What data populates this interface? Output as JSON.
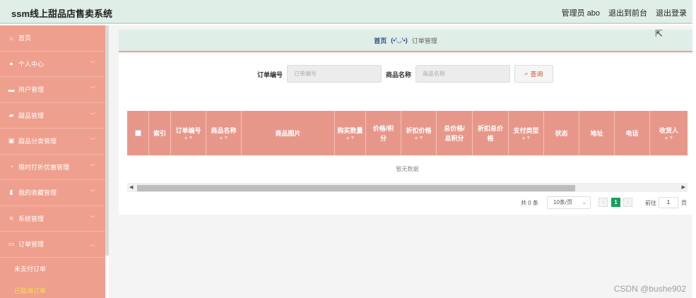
{
  "header": {
    "title": "ssm线上甜品店售卖系统",
    "user": "管理员 abo",
    "to_front": "退出到前台",
    "logout": "退出登录"
  },
  "sidebar": {
    "items": [
      {
        "label": "首页",
        "icon": "home-icon",
        "expanded": null
      },
      {
        "label": "个人中心",
        "icon": "person-icon",
        "expanded": false
      },
      {
        "label": "用户管理",
        "icon": "user-card-icon",
        "expanded": false
      },
      {
        "label": "甜品管理",
        "icon": "cake-icon",
        "expanded": false
      },
      {
        "label": "甜品分类管理",
        "icon": "category-icon",
        "expanded": false
      },
      {
        "label": "限时打折优惠管理",
        "icon": "timer-icon",
        "expanded": false
      },
      {
        "label": "我的收藏管理",
        "icon": "bar-chart-icon",
        "expanded": false
      },
      {
        "label": "系统管理",
        "icon": "menu-icon",
        "expanded": false
      },
      {
        "label": "订单管理",
        "icon": "order-icon",
        "expanded": true
      }
    ],
    "sub_items": [
      {
        "label": "未支付订单",
        "active": false
      },
      {
        "label": "已取消订单",
        "active": true
      }
    ]
  },
  "breadcrumb": {
    "home": "首页",
    "face": "(•'◡'•)",
    "current": "订单管理"
  },
  "search": {
    "order_no_label": "订单编号",
    "order_no_placeholder": "订单编号",
    "product_label": "商品名称",
    "product_placeholder": "商品名称",
    "query_button": "查询"
  },
  "table": {
    "columns": [
      "索引",
      "订单编号",
      "商品名称",
      "商品图片",
      "购买数量",
      "价格/积分",
      "折扣价格",
      "总价格/总积分",
      "折扣总价格",
      "支付类型",
      "状态",
      "地址",
      "电话",
      "收货人"
    ],
    "empty_text": "暂无数据"
  },
  "pagination": {
    "total": "共 0 条",
    "page_size": "10条/页",
    "current_page": "1",
    "goto_label": "前往",
    "goto_value": "1",
    "page_suffix": "页"
  },
  "colors": {
    "sidebar": "#ef9f8d",
    "header": "#dfeee6",
    "table_header": "#e7978a",
    "active_page": "#17a05e",
    "active_sub": "#f7e04a"
  },
  "watermark": "CSDN @bushe902"
}
